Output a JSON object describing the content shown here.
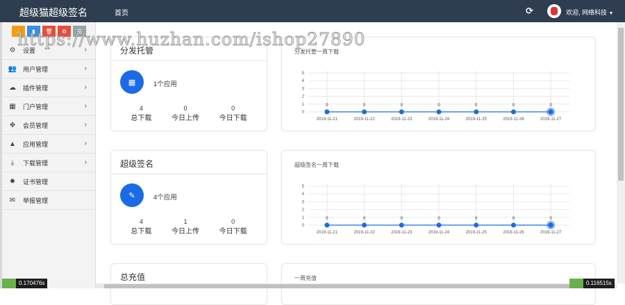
{
  "header": {
    "brand": "超级猫超级签名",
    "nav_home": "首页",
    "welcome": "欢迎, 网络科技",
    "refresh_icon": "refresh-icon"
  },
  "sidebar": {
    "quick_buttons": [
      {
        "icon": "home-icon",
        "color": "#f39c12"
      },
      {
        "icon": "file-icon",
        "color": "#3c8dde"
      },
      {
        "icon": "trash-icon",
        "color": "#e74c3c"
      },
      {
        "icon": "recycle-icon",
        "color": "#e74c3c"
      },
      {
        "icon": "list-icon",
        "color": "#95a5a6"
      }
    ],
    "items": [
      {
        "label": "设置",
        "icon": "cogs-icon",
        "glyph": "⚙",
        "has_children": true
      },
      {
        "label": "用户管理",
        "icon": "users-icon",
        "glyph": "👥",
        "has_children": true
      },
      {
        "label": "插件管理",
        "icon": "cloud-icon",
        "glyph": "☁",
        "has_children": true
      },
      {
        "label": "门户管理",
        "icon": "grid-icon",
        "glyph": "▦",
        "has_children": true
      },
      {
        "label": "会员管理",
        "icon": "move-icon",
        "glyph": "✥",
        "has_children": true
      },
      {
        "label": "应用管理",
        "icon": "android-icon",
        "glyph": "▲",
        "has_children": true
      },
      {
        "label": "下载管理",
        "icon": "download-icon",
        "glyph": "⤓",
        "has_children": true
      },
      {
        "label": "证书管理",
        "icon": "certificate-icon",
        "glyph": "✹",
        "has_children": false
      },
      {
        "label": "举报管理",
        "icon": "envelope-open-icon",
        "glyph": "✉",
        "has_children": false
      }
    ]
  },
  "cards": [
    {
      "title": "分发托管",
      "apps": "1个应用",
      "icon": "calendar-icon",
      "glyph": "▦",
      "stats": [
        {
          "value": "4",
          "label": "总下载"
        },
        {
          "value": "0",
          "label": "今日上传"
        },
        {
          "value": "0",
          "label": "今日下载"
        }
      ]
    },
    {
      "title": "超级签名",
      "apps": "4个应用",
      "icon": "pencil-icon",
      "glyph": "✎",
      "stats": [
        {
          "value": "4",
          "label": "总下载"
        },
        {
          "value": "1",
          "label": "今日上传"
        },
        {
          "value": "0",
          "label": "今日下载"
        }
      ]
    },
    {
      "title": "总充值"
    }
  ],
  "chart_data": [
    {
      "type": "line",
      "title": "分发托管一周下载",
      "categories": [
        "2019-11-21",
        "2019-11-22",
        "2019-11-23",
        "2019-11-24",
        "2019-11-25",
        "2019-11-26",
        "2019-11-27"
      ],
      "values": [
        0,
        0,
        0,
        0,
        0,
        0,
        0
      ],
      "yticks": [
        "0",
        "1",
        "2",
        "3",
        "4",
        "5"
      ],
      "ylim": [
        0,
        5
      ],
      "color": "#1c6be6"
    },
    {
      "type": "line",
      "title": "超级签名一周下载",
      "categories": [
        "2019-11-21",
        "2019-11-22",
        "2019-11-23",
        "2019-11-24",
        "2019-11-25",
        "2019-11-26",
        "2019-11-27"
      ],
      "values": [
        0,
        0,
        0,
        0,
        0,
        0,
        0
      ],
      "yticks": [
        "0",
        "1",
        "2",
        "3",
        "4",
        "5"
      ],
      "ylim": [
        0,
        5
      ],
      "color": "#1c6be6"
    },
    {
      "type": "line",
      "title": "一周充值"
    }
  ],
  "timers": {
    "left": "0.170476s",
    "right": "0.116515s"
  },
  "watermark": "https://www.huzhan.com/ishop27890"
}
